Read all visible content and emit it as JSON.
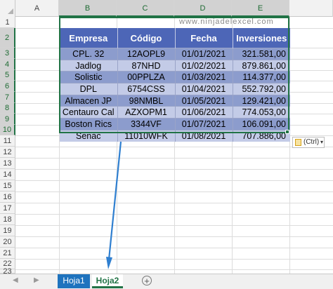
{
  "columns": [
    "A",
    "B",
    "C",
    "D",
    "E"
  ],
  "rows": [
    "1",
    "2",
    "3",
    "4",
    "5",
    "6",
    "7",
    "8",
    "9",
    "10",
    "11",
    "12",
    "13",
    "14",
    "15",
    "16",
    "17",
    "18",
    "19",
    "20",
    "21",
    "22",
    "23"
  ],
  "table": {
    "headers": [
      "Empresa",
      "Código",
      "Fecha",
      "Inversiones"
    ],
    "rows": [
      [
        "CPL. 32",
        "12AOPL9",
        "01/01/2021",
        "321.581,00"
      ],
      [
        "Jadlog",
        "87NHD",
        "01/02/2021",
        "879.861,00"
      ],
      [
        "Solistic",
        "00PPLZA",
        "01/03/2021",
        "114.377,00"
      ],
      [
        "DPL",
        "6754CSS",
        "01/04/2021",
        "552.792,00"
      ],
      [
        "Almacen JP",
        "98NMBL",
        "01/05/2021",
        "129.421,00"
      ],
      [
        "Centauro Cal",
        "AZXOPM1",
        "01/06/2021",
        "774.053,00"
      ],
      [
        "Boston Rics",
        "3344VF",
        "01/07/2021",
        "106.091,00"
      ],
      [
        "Senac",
        "11010WFK",
        "01/08/2021",
        "707.886,00"
      ]
    ]
  },
  "watermark": "www.ninjadelexcel.com",
  "paste_options": {
    "label": "(Ctrl)",
    "icon": "clipboard-icon"
  },
  "sheets": [
    "Hoja1",
    "Hoja2"
  ],
  "active_sheet": "Hoja2",
  "colors": {
    "header_bg": "#4d66b7",
    "row_dark": "#8c9ccd",
    "row_light": "#c3cbe7",
    "selection": "#217346",
    "arrow": "#2f7fd0"
  }
}
